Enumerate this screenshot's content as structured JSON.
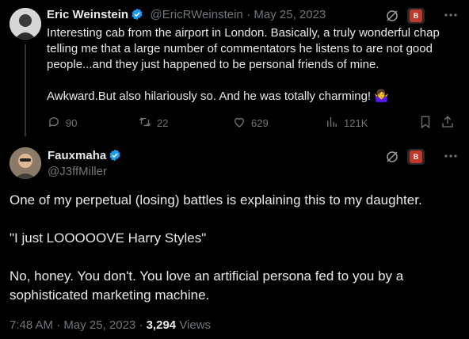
{
  "tweet1": {
    "name": "Eric Weinstein",
    "handle": "@EricRWeinstein",
    "date": "· May 25, 2023",
    "text": "Interesting cab from the airport in London. Basically, a truly wonderful chap telling me that a large number of commentators he listens to are not good people...and they just happened to be personal friends of mine.\n\nAwkward.But also hilariously so. And he was totally charming! 🤷‍♀️",
    "replies": "90",
    "retweets": "22",
    "likes": "629",
    "views": "121K",
    "ext_badge": "B"
  },
  "tweet2": {
    "name": "Fauxmaha",
    "handle": "@J3ffMiller",
    "paragraphs": [
      "One of my perpetual (losing) battles is explaining this to my daughter.",
      "\"I just LOOOOOVE Harry Styles\"",
      "No, honey. You don't. You love an artificial persona fed to you by a sophisticated marketing machine."
    ],
    "time": "7:48 AM · May 25, 2023 ·",
    "views_count": "3,294",
    "views_label": "Views",
    "ext_badge": "B"
  },
  "colors": {
    "verified": "#1d9bf0",
    "muted": "#71767b",
    "text": "#e7e9ea",
    "background": "#000000"
  },
  "icons": [
    "reply-icon",
    "retweet-icon",
    "like-icon",
    "views-icon",
    "bookmark-icon",
    "share-icon",
    "more-icon",
    "verified-icon",
    "slash-circle-icon"
  ]
}
